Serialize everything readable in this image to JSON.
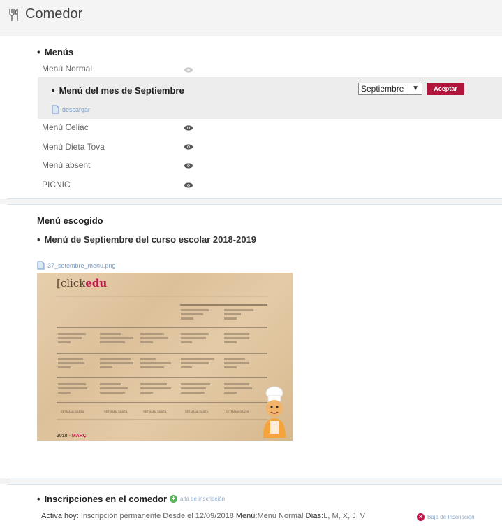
{
  "header": {
    "title": "Comedor",
    "icon": "fork-knife-icon"
  },
  "menus": {
    "section_title": "Menús",
    "items": [
      {
        "label": "Menú Normal"
      },
      {
        "label": "Menú Celiac"
      },
      {
        "label": "Menú Dieta Tova"
      },
      {
        "label": "Menú absent"
      },
      {
        "label": "PICNIC"
      }
    ],
    "selected": {
      "title": "Menú del mes de Septiembre",
      "month_value": "Septiembre",
      "accept_label": "Aceptar",
      "download_label": "descargar"
    }
  },
  "chosen": {
    "heading": "Menú escogido",
    "subtitle": "Menú de Septiembre del curso escolar 2018-2019",
    "file_name": "37_setembre_menu.png",
    "image": {
      "logo_prefix": "[click",
      "logo_brand": "edu",
      "footer_year": "2018 -",
      "footer_month": "MARÇ",
      "holy_week_label": "SETMANA SANTA"
    }
  },
  "inscriptions": {
    "title": "Inscripciones en el comedor",
    "alta_label": "alta de inscripción",
    "active_label": "Activa hoy:",
    "type": "Inscripción permanente",
    "since": "Desde el 12/09/2018",
    "menu_key": "Menú:",
    "menu_value": "Menú Normal",
    "days_key": "Días:",
    "days_value": "L, M, X, J, V",
    "baja_label": "Baja de Inscripción"
  },
  "colors": {
    "accent": "#b0163c",
    "link": "#7a9cc6",
    "add": "#53b556",
    "remove": "#c2154b",
    "panel_bg": "#f4f4f4"
  }
}
